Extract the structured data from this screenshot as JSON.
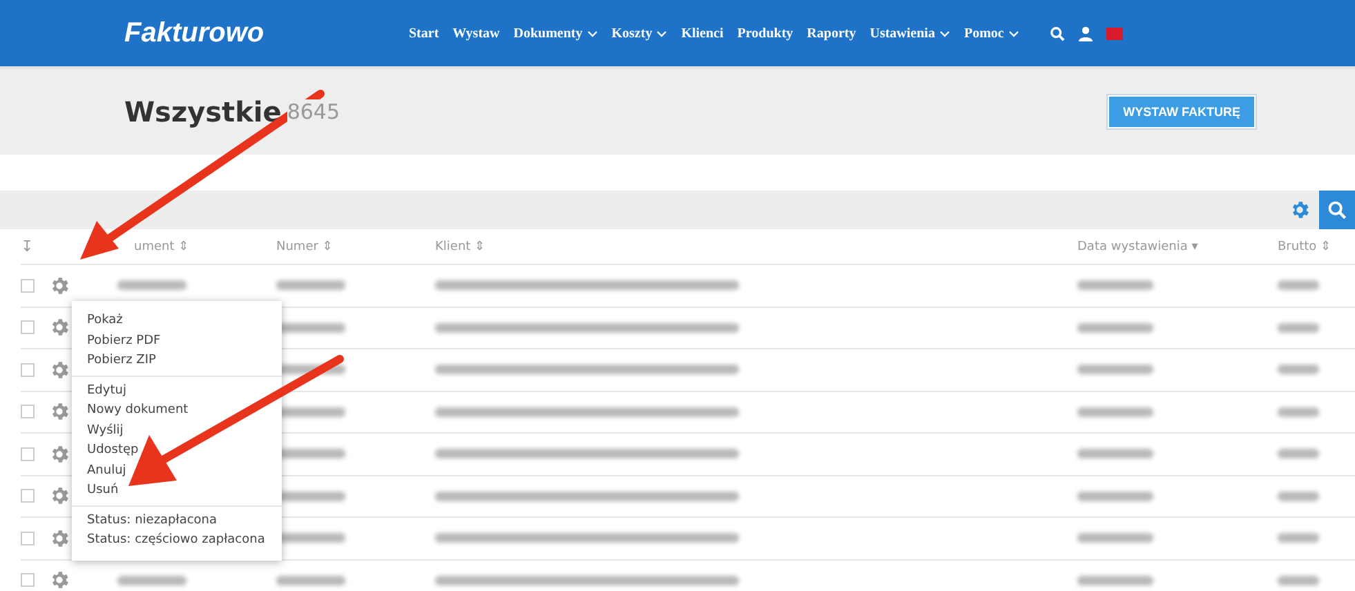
{
  "navbar": {
    "logo": "Fakturowo",
    "items": [
      {
        "label": "Start",
        "dropdown": false
      },
      {
        "label": "Wystaw",
        "dropdown": false
      },
      {
        "label": "Dokumenty",
        "dropdown": true
      },
      {
        "label": "Koszty",
        "dropdown": true
      },
      {
        "label": "Klienci",
        "dropdown": false
      },
      {
        "label": "Produkty",
        "dropdown": false
      },
      {
        "label": "Raporty",
        "dropdown": false
      },
      {
        "label": "Ustawienia",
        "dropdown": true
      },
      {
        "label": "Pomoc",
        "dropdown": true
      }
    ]
  },
  "header": {
    "title": "Wszystkie",
    "count": "8645",
    "button": "WYSTAW FAKTURĘ"
  },
  "table": {
    "sort_icon": "↧",
    "columns": [
      {
        "label": "ument ⇕",
        "kind": "doc"
      },
      {
        "label": "Numer ⇕",
        "kind": "num"
      },
      {
        "label": "Klient ⇕",
        "kind": "client"
      },
      {
        "label": "Data wystawienia ▾",
        "kind": "date"
      },
      {
        "label": "Brutto ⇕",
        "kind": "amount"
      }
    ],
    "rows": [
      {
        "checked": false
      },
      {
        "checked": false
      },
      {
        "checked": false
      },
      {
        "checked": false
      },
      {
        "checked": false
      },
      {
        "checked": false
      },
      {
        "checked": false
      },
      {
        "checked": false
      }
    ]
  },
  "menu": {
    "groups": [
      [
        "Pokaż",
        "Pobierz PDF",
        "Pobierz ZIP"
      ],
      [
        "Edytuj",
        "Nowy dokument",
        "Wyślij",
        "Udostęp",
        "Anuluj",
        "Usuń"
      ],
      [
        "Status: niezapłacona",
        "Status: częściowo zapłacona"
      ]
    ]
  }
}
